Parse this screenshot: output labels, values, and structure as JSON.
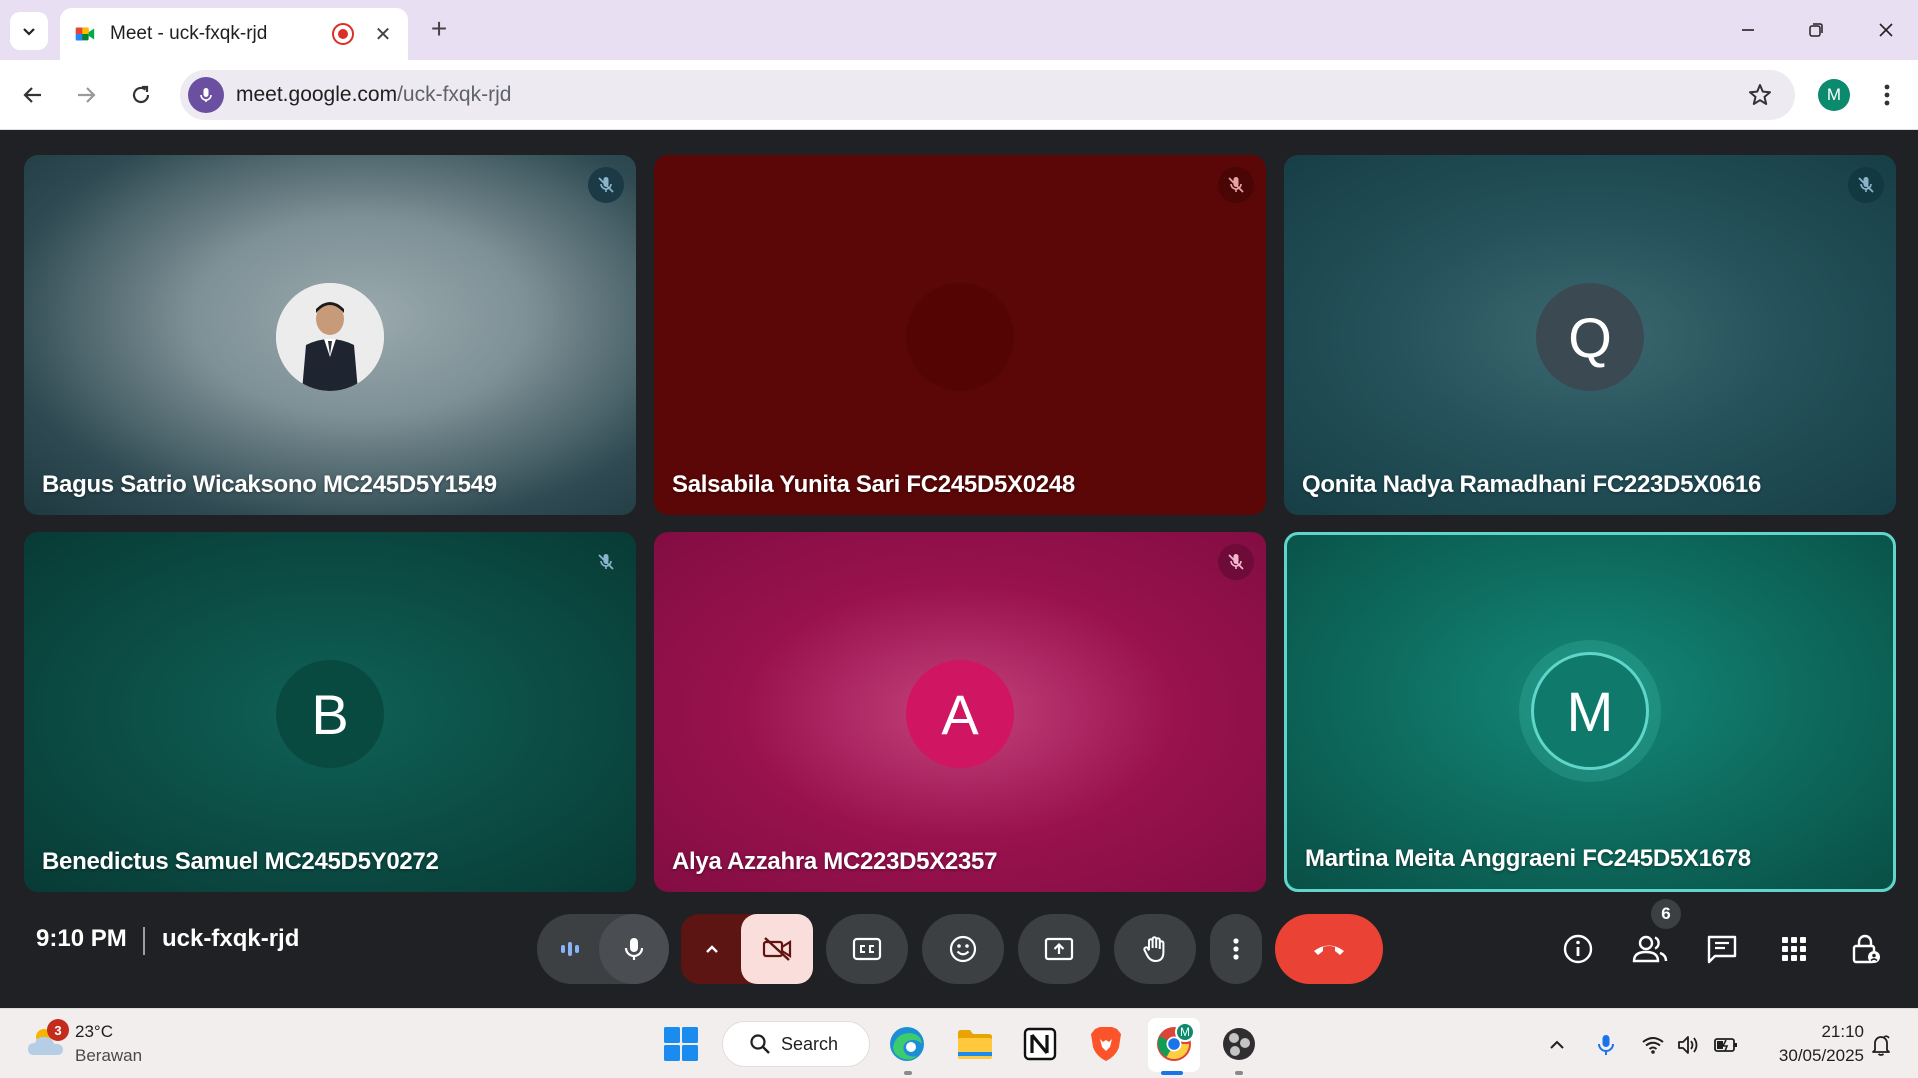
{
  "browser": {
    "tab_title": "Meet - uck-fxqk-rjd",
    "url_host": "meet.google.com",
    "url_path": "/uck-fxqk-rjd",
    "profile_initial": "M"
  },
  "meeting": {
    "time": "9:10 PM",
    "code": "uck-fxqk-rjd",
    "participant_count": "6",
    "participants": [
      {
        "name": "Bagus Satrio Wicaksono MC245D5Y1549",
        "avatar": "",
        "muted": true,
        "tile_color": "#5f7b82"
      },
      {
        "name": "Salsabila Yunita Sari FC245D5X0248",
        "avatar": "",
        "muted": true,
        "tile_color": "#5b0707"
      },
      {
        "name": "Qonita Nadya Ramadhani FC223D5X0616",
        "avatar": "Q",
        "muted": true,
        "tile_color": "#25525b"
      },
      {
        "name": "Benedictus Samuel MC245D5Y0272",
        "avatar": "B",
        "muted": true,
        "tile_color": "#0b4c44"
      },
      {
        "name": "Alya Azzahra MC223D5X2357",
        "avatar": "A",
        "muted": true,
        "tile_color": "#99124e"
      },
      {
        "name": "Martina Meita Anggraeni FC245D5X1678",
        "avatar": "M",
        "muted": false,
        "tile_color": "#0e6e60"
      }
    ],
    "end_call_color": "#ea4335"
  },
  "taskbar": {
    "weather_badge": "3",
    "temperature": "23°C",
    "weather_desc": "Berawan",
    "search_label": "Search",
    "chrome_badge": "M",
    "clock_time": "21:10",
    "clock_date": "30/05/2025"
  }
}
